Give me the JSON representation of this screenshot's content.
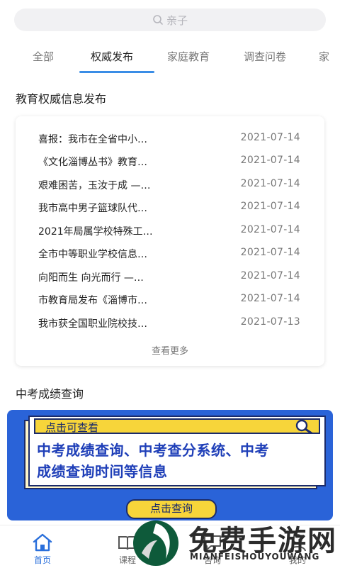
{
  "search": {
    "placeholder": "亲子"
  },
  "tabs": [
    {
      "label": "全部"
    },
    {
      "label": "权威发布"
    },
    {
      "label": "家庭教育"
    },
    {
      "label": "调查问卷"
    },
    {
      "label": "家"
    }
  ],
  "section_news": {
    "title": "教育权威信息发布"
  },
  "news": [
    {
      "title": "喜报：我市在全省中小…",
      "date": "2021-07-14"
    },
    {
      "title": "《文化淄博丛书》教育…",
      "date": "2021-07-14"
    },
    {
      "title": "艰难困苦，玉汝于成 —…",
      "date": "2021-07-14"
    },
    {
      "title": "我市高中男子篮球队代…",
      "date": "2021-07-14"
    },
    {
      "title": "2021年局属学校特殊工…",
      "date": "2021-07-14"
    },
    {
      "title": "全市中等职业学校信息…",
      "date": "2021-07-14"
    },
    {
      "title": "向阳而生 向光而行 —…",
      "date": "2021-07-14"
    },
    {
      "title": "市教育局发布《淄博市…",
      "date": "2021-07-14"
    },
    {
      "title": "我市获全国职业院校技…",
      "date": "2021-07-13"
    }
  ],
  "more_label": "查看更多",
  "section_exam": {
    "title": "中考成绩查询"
  },
  "banner": {
    "head": "点击可查看",
    "line1": "中考成绩查询、中考查分系统、中考",
    "line2": "成绩查询时间等信息",
    "button": "点击查询"
  },
  "tabbar": [
    {
      "label": "首页",
      "icon": "home-icon"
    },
    {
      "label": "课程",
      "icon": "book-icon"
    },
    {
      "label": "咨询",
      "icon": "chat-icon"
    },
    {
      "label": "我的",
      "icon": "user-icon"
    }
  ],
  "watermark": {
    "title": "免费手游网",
    "subtitle": "MIANFEISHOUYOUWANG"
  },
  "colors": {
    "accent": "#3a8de6",
    "banner_bg": "#2a63d8",
    "banner_yellow": "#f7d53a"
  }
}
